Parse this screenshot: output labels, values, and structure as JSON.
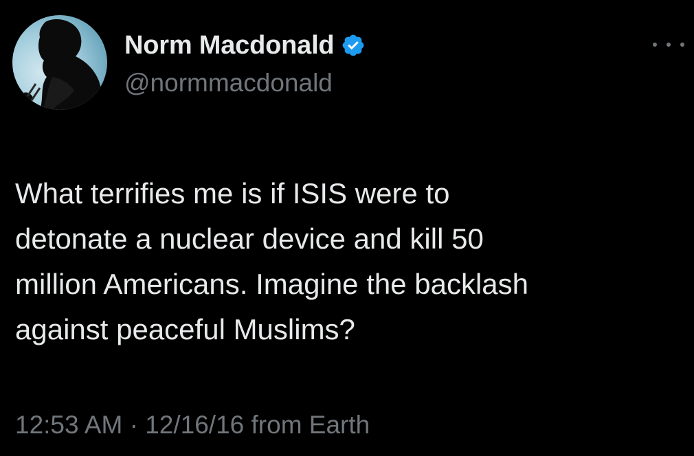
{
  "tweet": {
    "author": {
      "display_name": "Norm Macdonald",
      "handle": "@normmacdonald",
      "verified": true,
      "avatar_icon": "profile-photo"
    },
    "more_icon": "ellipsis-icon",
    "body_lines": [
      "What terrifies me is if ISIS were to",
      "detonate a nuclear device and kill 50",
      "million Americans. Imagine the backlash",
      "against peaceful Muslims?"
    ],
    "timestamp": "12:53 AM · 12/16/16 from Earth"
  },
  "colors": {
    "background": "#000000",
    "primary_text": "#e7e9ea",
    "secondary_text": "#71767b",
    "verified_badge": "#1d9bf0"
  }
}
